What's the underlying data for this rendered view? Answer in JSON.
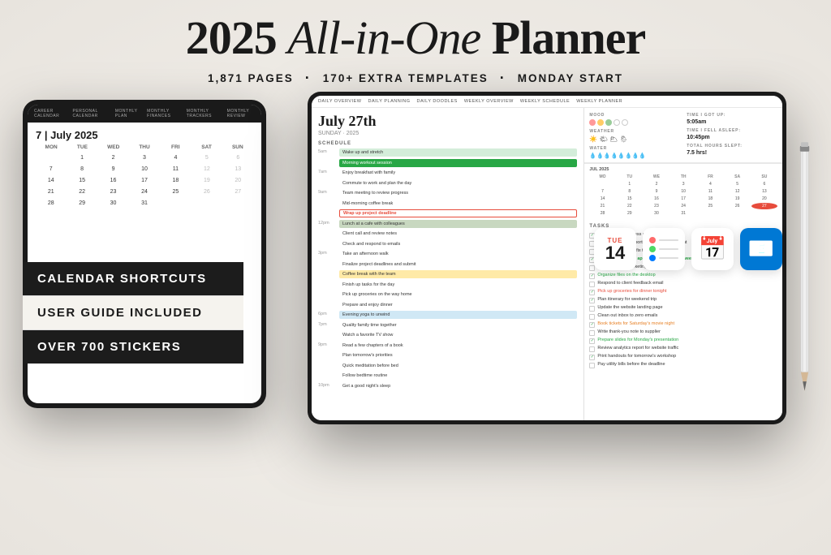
{
  "header": {
    "title_part1": "2025 ",
    "title_italic": "All-in-One",
    "title_part2": " Planner",
    "subtitle_pages": "1,871 PAGES",
    "subtitle_templates": "170+ EXTRA TEMPLATES",
    "subtitle_start": "MONDAY START"
  },
  "badges": {
    "badge1": "CALENDAR SHORTCUTS",
    "badge2": "USER GUIDE INCLUDED",
    "badge3": "OVER 700 STICKERS"
  },
  "left_tablet": {
    "nav_items": [
      "CAREER CALENDAR",
      "PERSONAL CALENDAR",
      "MONTHLY PLAN",
      "MONTHLY FINANCES",
      "MONTHLY TRACKERS",
      "MONTHLY REVIEW"
    ],
    "date": "7  |  July 2025",
    "calendar_days": [
      "MON",
      "TUE",
      "WED",
      "THU",
      "FRI",
      "SAT",
      "SUN"
    ],
    "calendar_nums": [
      "",
      "1",
      "2",
      "3",
      "4",
      "5",
      "6",
      "7",
      "8",
      "9",
      "10",
      "11",
      "12",
      "13",
      "14",
      "15",
      "16",
      "17",
      "18",
      "19",
      "20",
      "21",
      "22",
      "23",
      "24",
      "25",
      "26",
      "27",
      "28",
      "29",
      "30",
      "31",
      "",
      "",
      ""
    ]
  },
  "right_tablet": {
    "nav_items": [
      "DAILY OVERVIEW",
      "DAILY PLANNING",
      "DAILY DOODLES",
      "WEEKLY OVERVIEW",
      "WEEKLY SCHEDULE",
      "WEEKLY PLANNER"
    ],
    "date": "July 27th",
    "day": "SUNDAY · 2025",
    "schedule_label": "SCHEDULE",
    "tasks_label": "TASKS",
    "schedule": [
      {
        "time": "5am",
        "text": "Wake up and stretch",
        "color": "green"
      },
      {
        "time": "",
        "text": "Morning workout session",
        "color": "green-dark"
      },
      {
        "time": "7am",
        "text": "Enjoy breakfast with family",
        "color": "empty"
      },
      {
        "time": "",
        "text": "Commute to work and plan the day",
        "color": "empty"
      },
      {
        "time": "9am",
        "text": "Team meeting to review progress",
        "color": "empty"
      },
      {
        "time": "",
        "text": "Mid-morning coffee break",
        "color": "empty"
      },
      {
        "time": "",
        "text": "Wrap up project deadline",
        "color": "red-outline"
      },
      {
        "time": "12pm",
        "text": "Lunch at a cafe with colleagues",
        "color": "sage"
      },
      {
        "time": "",
        "text": "Client call and review notes",
        "color": "empty"
      },
      {
        "time": "",
        "text": "Check and respond to emails",
        "color": "empty"
      },
      {
        "time": "3pm",
        "text": "Take an afternoon walk",
        "color": "empty"
      },
      {
        "time": "",
        "text": "Finalize project deadlines and submit",
        "color": "empty"
      },
      {
        "time": "",
        "text": "Coffee break with the team",
        "color": "orange"
      },
      {
        "time": "",
        "text": "Finish up tasks for the day",
        "color": "empty"
      },
      {
        "time": "",
        "text": "Pick up groceries on the way home",
        "color": "empty"
      },
      {
        "time": "",
        "text": "Prepare and enjoy dinner",
        "color": "empty"
      },
      {
        "time": "6pm",
        "text": "Evening yoga to unwind",
        "color": "blue"
      },
      {
        "time": "7pm",
        "text": "Quality family time together",
        "color": "empty"
      },
      {
        "time": "",
        "text": "Watch a favorite TV show",
        "color": "empty"
      },
      {
        "time": "9pm",
        "text": "Read a few chapters of a book",
        "color": "empty"
      },
      {
        "time": "",
        "text": "Plan tomorrow's priorities",
        "color": "empty"
      },
      {
        "time": "",
        "text": "Quick meditation before bed",
        "color": "empty"
      },
      {
        "time": "",
        "text": "Follow bedtime routine",
        "color": "empty"
      },
      {
        "time": "10pm",
        "text": "Get a good night's sleep",
        "color": "empty"
      }
    ],
    "tasks": [
      {
        "text": "Write weekly progress report for the team",
        "checked": true,
        "style": "normal"
      },
      {
        "text": "Submit expense report to finance department",
        "checked": false,
        "style": "normal"
      },
      {
        "text": "Call the plumber to fix the sink",
        "checked": false,
        "style": "normal"
      },
      {
        "text": "Schedule doctor's appointment for next week",
        "checked": true,
        "style": "highlighted"
      },
      {
        "text": "Research new marketing strategies for Q1",
        "checked": false,
        "style": "normal"
      },
      {
        "text": "Organize files on the desktop",
        "checked": true,
        "style": "green"
      },
      {
        "text": "Respond to client feedback email",
        "checked": false,
        "style": "normal"
      },
      {
        "text": "Pick up groceries for dinner tonight",
        "checked": true,
        "style": "pink"
      },
      {
        "text": "Plan itinerary for weekend trip",
        "checked": true,
        "style": "normal"
      },
      {
        "text": "Update the website landing page",
        "checked": false,
        "style": "normal"
      },
      {
        "text": "Clean out inbox to zero emails",
        "checked": false,
        "style": "normal"
      },
      {
        "text": "Book tickets for Saturday's movie night",
        "checked": true,
        "style": "orange"
      },
      {
        "text": "Write thank-you note to supplier",
        "checked": false,
        "style": "normal"
      },
      {
        "text": "Prepare slides for Monday's presentation",
        "checked": true,
        "style": "green"
      },
      {
        "text": "Review analytics report for website traffic",
        "checked": false,
        "style": "normal"
      },
      {
        "text": "Print handouts for tomorrow's workshop",
        "checked": true,
        "style": "normal"
      },
      {
        "text": "Pay utility bills before the deadline",
        "checked": false,
        "style": "normal"
      }
    ]
  },
  "app_icons": {
    "calendar_day": "14",
    "calendar_day_label": "TUE",
    "reminders_label": "Reminders",
    "gcal_label": "Google Calendar",
    "outlook_label": "Outlook"
  }
}
